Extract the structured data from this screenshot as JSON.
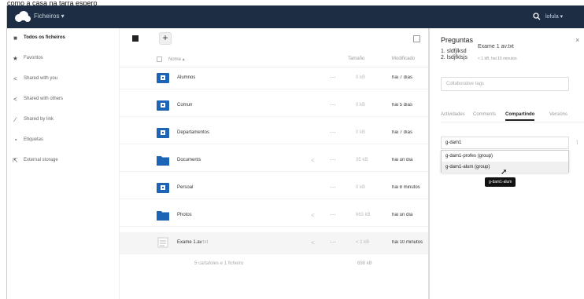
{
  "caption": "como a casa na tarra espero",
  "header": {
    "app_menu": "Ficheiros ▾",
    "user_menu": "lofula ▾"
  },
  "sidebar": {
    "items": [
      {
        "label": "Todos os ficheiros",
        "icon": "folder-icon"
      },
      {
        "label": "Favoritos",
        "icon": "star-icon"
      },
      {
        "label": "Shared with you",
        "icon": "share-icon"
      },
      {
        "label": "Shared with others",
        "icon": "share-icon"
      },
      {
        "label": "Shared by link",
        "icon": "link-icon"
      },
      {
        "label": "Etiquetas",
        "icon": "tag-icon"
      },
      {
        "label": "External storage",
        "icon": "external-storage-icon"
      }
    ]
  },
  "files": {
    "new_label": "+",
    "columns": {
      "name": "Nome ▴",
      "size": "Tamaño",
      "modified": "Modificado"
    },
    "rows": [
      {
        "name": "Alumnos",
        "ext": "",
        "type": "shared-folder",
        "size": "0 kB",
        "modified": "hai 7 días",
        "shared": false
      },
      {
        "name": "Comun",
        "ext": "",
        "type": "shared-folder",
        "size": "0 kB",
        "modified": "hai 5 días",
        "shared": false
      },
      {
        "name": "Departamentos",
        "ext": "",
        "type": "shared-folder",
        "size": "0 kB",
        "modified": "hai 7 días",
        "shared": false
      },
      {
        "name": "Documents",
        "ext": "",
        "type": "folder",
        "size": "35 kB",
        "modified": "hai un día",
        "shared": true
      },
      {
        "name": "Persoal",
        "ext": "",
        "type": "shared-folder",
        "size": "0 kB",
        "modified": "hai 8 minutos",
        "shared": false
      },
      {
        "name": "Photos",
        "ext": "",
        "type": "folder",
        "size": "663 kB",
        "modified": "hai un día",
        "shared": true
      },
      {
        "name": "Exame 1.av",
        "ext": ".txt",
        "type": "text-file",
        "size": "< 1 kB",
        "modified": "hai 10 minutos",
        "shared": true
      }
    ],
    "summary": {
      "count": "5 cartafoles e 1 ficheiro",
      "total": "698 kB"
    }
  },
  "details": {
    "title": "Preguntas",
    "subtitle": "Exame 1 av.txt",
    "lines": [
      "1. sldfjlksd",
      "2. lsdjfklsjs"
    ],
    "meta": "< 1 kB, hai 10 minutos",
    "tags_placeholder": "Collaborative tags",
    "tabs": [
      "Actividades",
      "Comments",
      "Compartindo",
      "Versións"
    ],
    "active_tab": "Compartindo",
    "share_input": "g-dam1",
    "options": [
      "g-dam1-profes (group)",
      "g-dam1-alum (group)"
    ],
    "tooltip": "g-dam1-alum"
  },
  "colors": {
    "header_bg": "#1d2d44",
    "folder_blue": "#1d63b6"
  }
}
